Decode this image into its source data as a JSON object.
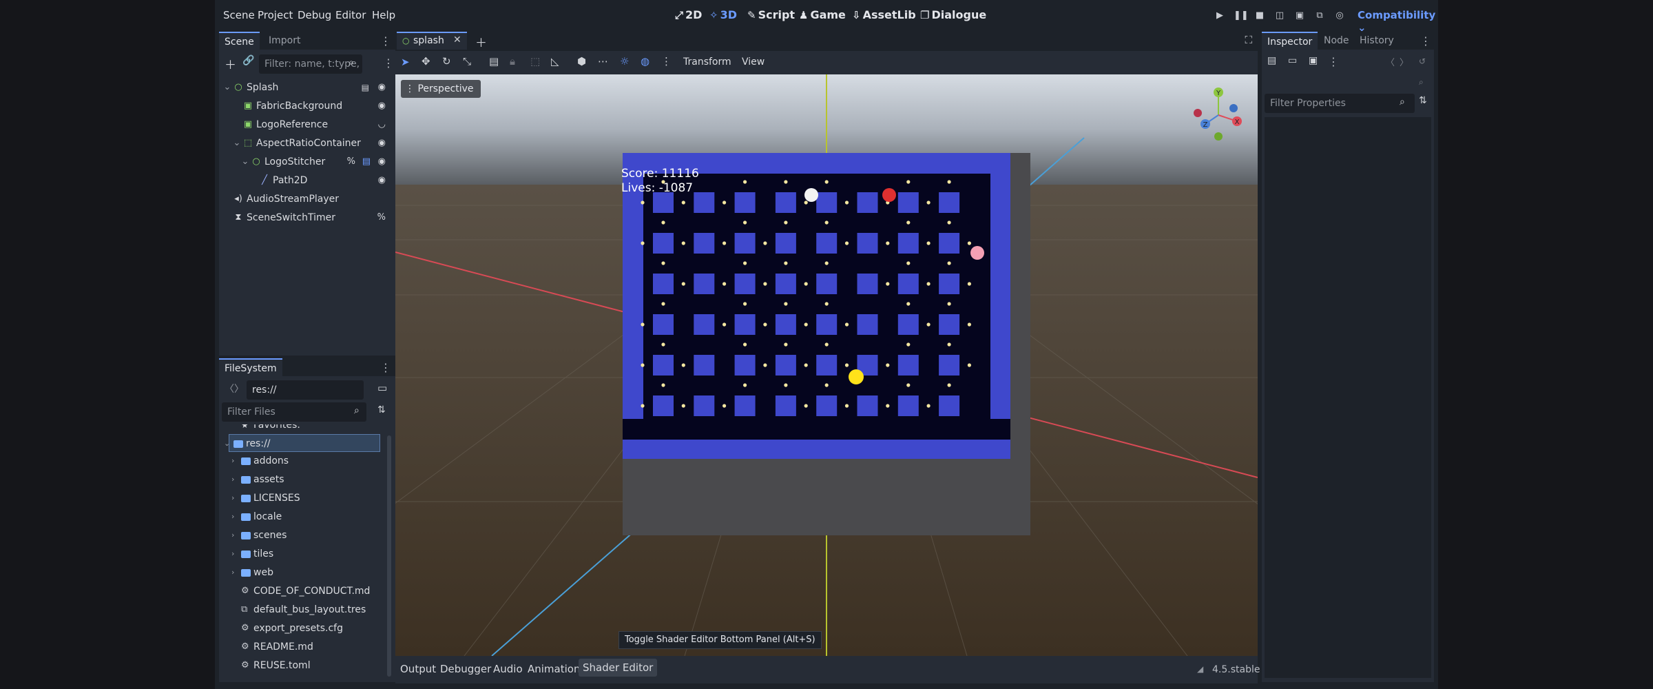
{
  "menus": [
    "Scene",
    "Project",
    "Debug",
    "Editor",
    "Help"
  ],
  "workspaces": [
    {
      "label": "2D",
      "icon": "2d-icon",
      "glyph": "⤢"
    },
    {
      "label": "3D",
      "icon": "3d-icon",
      "glyph": "✧"
    },
    {
      "label": "Script",
      "icon": "script-icon",
      "glyph": "✎"
    },
    {
      "label": "Game",
      "icon": "game-icon",
      "glyph": "♟"
    },
    {
      "label": "AssetLib",
      "icon": "assetlib-icon",
      "glyph": "⇩"
    },
    {
      "label": "Dialogue",
      "icon": "dialogue-icon",
      "glyph": "❐"
    }
  ],
  "renderer": "Compatibility",
  "scene_dock": {
    "tabs": [
      "Scene",
      "Import"
    ],
    "filter_placeholder": "Filter: name, t:type,",
    "nodes": [
      {
        "label": "Splash",
        "icon": "node-icon"
      },
      {
        "label": "FabricBackground",
        "icon": "texture-rect-icon"
      },
      {
        "label": "LogoReference",
        "icon": "texture-rect-icon"
      },
      {
        "label": "AspectRatioContainer",
        "icon": "aspect-ratio-container-icon"
      },
      {
        "label": "LogoStitcher",
        "icon": "node-icon"
      },
      {
        "label": "Path2D",
        "icon": "path2d-icon"
      },
      {
        "label": "AudioStreamPlayer",
        "icon": "audio-stream-player-icon"
      },
      {
        "label": "SceneSwitchTimer",
        "icon": "timer-icon"
      }
    ]
  },
  "filesystem": {
    "tab": "FileSystem",
    "path": "res://",
    "filter_placeholder": "Filter Files",
    "favorites": "Favorites:",
    "root": "res://",
    "folders": [
      "addons",
      "assets",
      "LICENSES",
      "locale",
      "scenes",
      "tiles",
      "web"
    ],
    "files": [
      "CODE_OF_CONDUCT.md",
      "default_bus_layout.tres",
      "export_presets.cfg",
      "README.md",
      "REUSE.toml"
    ]
  },
  "editor_tab": "splash",
  "toolbar": {
    "transform": "Transform",
    "view": "View"
  },
  "viewport": {
    "perspective": "Perspective",
    "tooltip": "Toggle Shader Editor Bottom Panel (Alt+S)"
  },
  "game": {
    "score": "Score: 11116",
    "lives": "Lives: -1087"
  },
  "gizmo": {
    "y": "Y",
    "x": "X",
    "z": "Z"
  },
  "inspector": {
    "tabs": [
      "Inspector",
      "Node",
      "History"
    ],
    "filter_placeholder": "Filter Properties"
  },
  "bottom_tabs": [
    "Output",
    "Debugger",
    "Audio",
    "Animation",
    "Shader Editor"
  ],
  "version": "4.5.stable",
  "colors": {
    "accent": "#6b9bff",
    "maze_wall": "#3f48cc",
    "maze_floor": "#05051e",
    "pellet": "#f4e7a1",
    "pacman": "#ffe21a",
    "ghost_red": "#e03030",
    "ghost_pink": "#f5a0b4",
    "ghost_white": "#f2f2f2"
  }
}
